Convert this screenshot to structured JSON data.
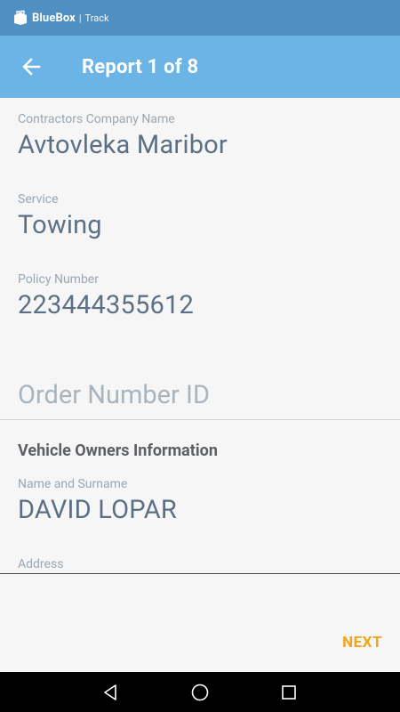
{
  "status_bar": {
    "brand": "BlueBox",
    "sub": "Track",
    "separator": "|"
  },
  "app_bar": {
    "title": "Report 1 of 8"
  },
  "form": {
    "contractor": {
      "label": "Contractors Company Name",
      "value": "Avtovleka Maribor"
    },
    "service": {
      "label": "Service",
      "value": "Towing"
    },
    "policy": {
      "label": "Policy Number",
      "value": "223444355612"
    },
    "order_number": {
      "placeholder": "Order Number ID",
      "value": ""
    }
  },
  "owner_section": {
    "title": "Vehicle Owners Information",
    "name": {
      "label": "Name and Surname",
      "value": "DAVID LOPAR"
    },
    "address": {
      "label": "Address",
      "value": ""
    }
  },
  "actions": {
    "next_label": "NEXT"
  },
  "colors": {
    "status_bar": "#4f8fc1",
    "app_bar": "#6cb3e6",
    "accent": "#f2a51a",
    "value_text": "#5b7085",
    "label_text": "#9aa7b3"
  }
}
